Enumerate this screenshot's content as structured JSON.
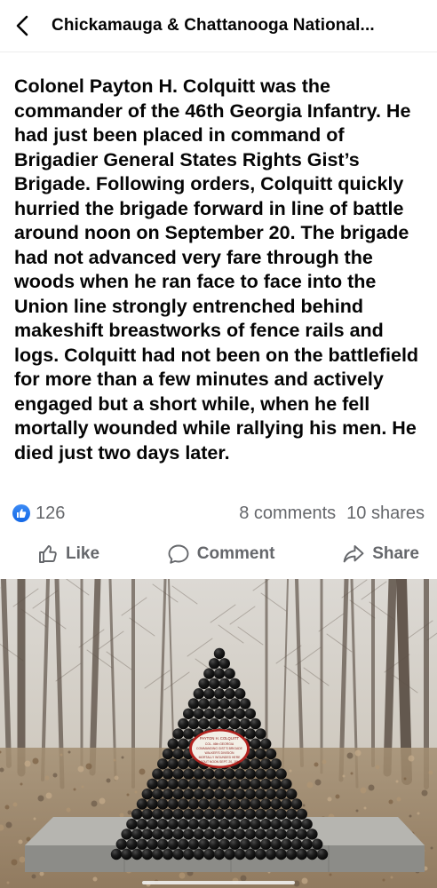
{
  "header": {
    "title": "Chickamauga & Chattanooga National...",
    "back_icon": "chevron-left-icon"
  },
  "post": {
    "text": "Colonel Payton H. Colquitt was the commander of the 46th Georgia Infantry. He had just been placed in command of Brigadier General States Rights Gist’s Brigade. Following orders, Colquitt quickly hurried the brigade forward in line of battle around noon on September 20. The brigade had not advanced very fare through the woods when he ran face to face into the Union line strongly entrenched behind makeshift breastworks of fence rails and logs. Colquitt had not been on the battlefield for more than a few minutes and actively engaged but a short while, when he fell mortally wounded while rallying his men. He died just two days later."
  },
  "engagement": {
    "reaction_count": "126",
    "comments": "8 comments",
    "shares": "10 shares",
    "reaction_icon": "thumbs-up-icon",
    "accent": "#1877f2"
  },
  "actions": {
    "like": "Like",
    "comment": "Comment",
    "share": "Share",
    "like_icon": "thumbs-up-outline-icon",
    "comment_icon": "speech-bubble-icon",
    "share_icon": "share-arrow-icon"
  },
  "photo": {
    "plaque_text": "PAYTON H. COLQUITT COL. 46th GEORGIA COMMANDING GIST'S BRIGADE WALKER'S DIVISION MORTALLY WOUNDED HERE ABOUT NOON SEPT. 20, 1863"
  },
  "colors": {
    "text_primary": "#050505",
    "text_secondary": "#65676b",
    "divider": "#ececec"
  }
}
